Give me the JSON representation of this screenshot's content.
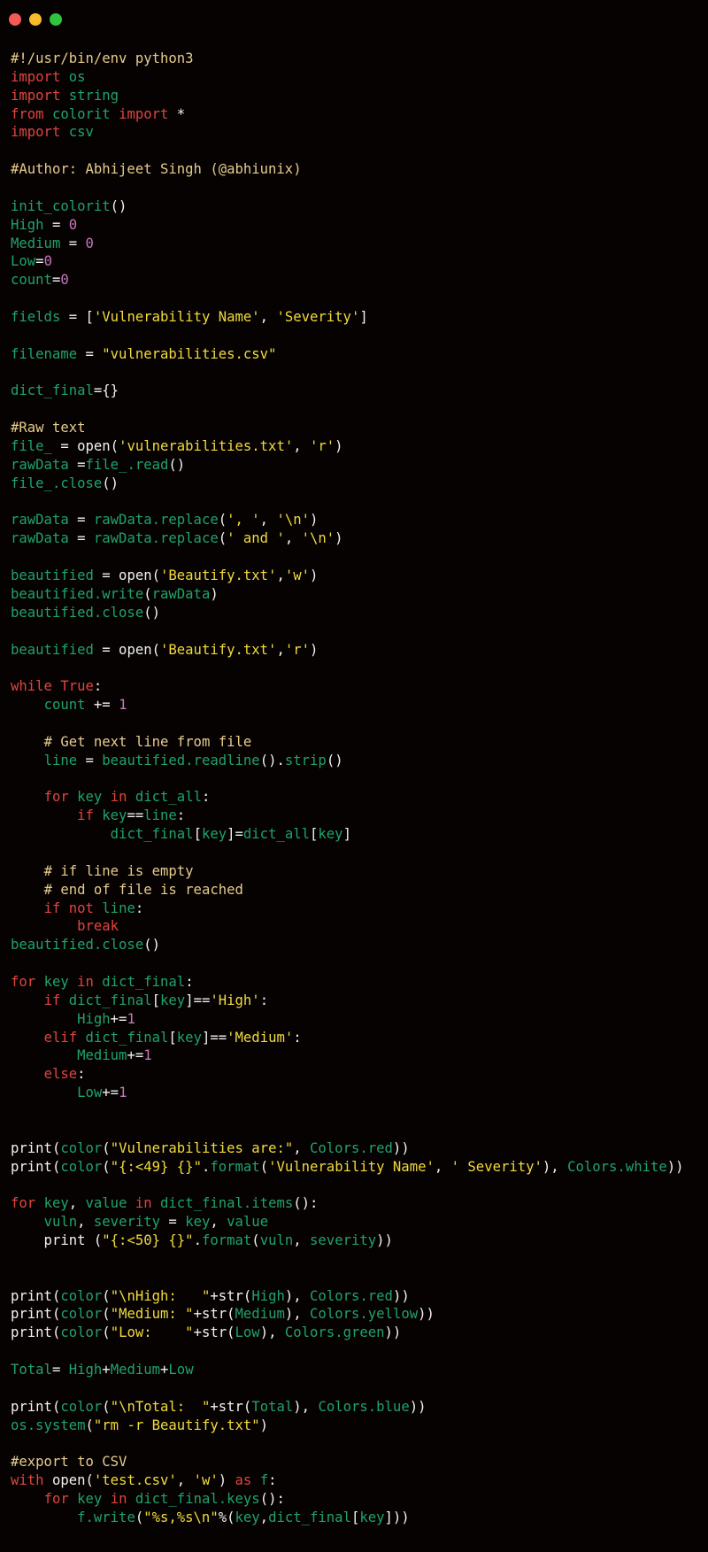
{
  "window": {
    "controls": [
      {
        "name": "close",
        "color": "#f25a57"
      },
      {
        "name": "minimize",
        "color": "#f6bb2e"
      },
      {
        "name": "maximize",
        "color": "#2fc43d"
      }
    ]
  },
  "theme": {
    "background": "#060202",
    "keyword": "#e0443e",
    "identifier": "#1fa36b",
    "string": "#f1db3c",
    "comment": "#e6cc8c",
    "number": "#c678b8",
    "plain": "#f2f2f2"
  },
  "code": {
    "language": "python",
    "lines": [
      [
        [
          "com",
          "#!/usr/bin/env python3"
        ]
      ],
      [
        [
          "kw",
          "import"
        ],
        [
          "op",
          " "
        ],
        [
          "id",
          "os"
        ]
      ],
      [
        [
          "kw",
          "import"
        ],
        [
          "op",
          " "
        ],
        [
          "id",
          "string"
        ]
      ],
      [
        [
          "kw",
          "from"
        ],
        [
          "op",
          " "
        ],
        [
          "id",
          "colorit"
        ],
        [
          "op",
          " "
        ],
        [
          "kw",
          "import"
        ],
        [
          "op",
          " *"
        ]
      ],
      [
        [
          "kw",
          "import"
        ],
        [
          "op",
          " "
        ],
        [
          "id",
          "csv"
        ]
      ],
      [],
      [
        [
          "com",
          "#Author: Abhijeet Singh (@abhiunix)"
        ]
      ],
      [],
      [
        [
          "id",
          "init_colorit"
        ],
        [
          "op",
          "()"
        ]
      ],
      [
        [
          "id",
          "High"
        ],
        [
          "op",
          " = "
        ],
        [
          "num",
          "0"
        ]
      ],
      [
        [
          "id",
          "Medium"
        ],
        [
          "op",
          " = "
        ],
        [
          "num",
          "0"
        ]
      ],
      [
        [
          "id",
          "Low"
        ],
        [
          "op",
          "="
        ],
        [
          "num",
          "0"
        ]
      ],
      [
        [
          "id",
          "count"
        ],
        [
          "op",
          "="
        ],
        [
          "num",
          "0"
        ]
      ],
      [],
      [
        [
          "id",
          "fields"
        ],
        [
          "op",
          " = ["
        ],
        [
          "str",
          "'Vulnerability Name'"
        ],
        [
          "op",
          ", "
        ],
        [
          "str",
          "'Severity'"
        ],
        [
          "op",
          "]"
        ]
      ],
      [],
      [
        [
          "id",
          "filename"
        ],
        [
          "op",
          " = "
        ],
        [
          "str",
          "\"vulnerabilities.csv\""
        ]
      ],
      [],
      [
        [
          "id",
          "dict_final"
        ],
        [
          "op",
          "={}"
        ]
      ],
      [],
      [
        [
          "com",
          "#Raw text"
        ]
      ],
      [
        [
          "id",
          "file_"
        ],
        [
          "op",
          " = open("
        ],
        [
          "str",
          "'vulnerabilities.txt'"
        ],
        [
          "op",
          ", "
        ],
        [
          "str",
          "'r'"
        ],
        [
          "op",
          ")"
        ]
      ],
      [
        [
          "id",
          "rawData"
        ],
        [
          "op",
          " ="
        ],
        [
          "id",
          "file_.read"
        ],
        [
          "op",
          "()"
        ]
      ],
      [
        [
          "id",
          "file_.close"
        ],
        [
          "op",
          "()"
        ]
      ],
      [],
      [
        [
          "id",
          "rawData"
        ],
        [
          "op",
          " = "
        ],
        [
          "id",
          "rawData.replace"
        ],
        [
          "op",
          "("
        ],
        [
          "str",
          "', '"
        ],
        [
          "op",
          ", "
        ],
        [
          "str",
          "'\\n'"
        ],
        [
          "op",
          ")"
        ]
      ],
      [
        [
          "id",
          "rawData"
        ],
        [
          "op",
          " = "
        ],
        [
          "id",
          "rawData.replace"
        ],
        [
          "op",
          "("
        ],
        [
          "str",
          "' and '"
        ],
        [
          "op",
          ", "
        ],
        [
          "str",
          "'\\n'"
        ],
        [
          "op",
          ")"
        ]
      ],
      [],
      [
        [
          "id",
          "beautified"
        ],
        [
          "op",
          " = open("
        ],
        [
          "str",
          "'Beautify.txt'"
        ],
        [
          "op",
          ","
        ],
        [
          "str",
          "'w'"
        ],
        [
          "op",
          ")"
        ]
      ],
      [
        [
          "id",
          "beautified.write"
        ],
        [
          "op",
          "("
        ],
        [
          "id",
          "rawData"
        ],
        [
          "op",
          ")"
        ]
      ],
      [
        [
          "id",
          "beautified.close"
        ],
        [
          "op",
          "()"
        ]
      ],
      [],
      [
        [
          "id",
          "beautified"
        ],
        [
          "op",
          " = open("
        ],
        [
          "str",
          "'Beautify.txt'"
        ],
        [
          "op",
          ","
        ],
        [
          "str",
          "'r'"
        ],
        [
          "op",
          ")"
        ]
      ],
      [],
      [
        [
          "kw",
          "while"
        ],
        [
          "op",
          " "
        ],
        [
          "kw",
          "True"
        ],
        [
          "op",
          ":"
        ]
      ],
      [
        [
          "op",
          "    "
        ],
        [
          "id",
          "count"
        ],
        [
          "op",
          " += "
        ],
        [
          "num",
          "1"
        ]
      ],
      [],
      [
        [
          "op",
          "    "
        ],
        [
          "com",
          "# Get next line from file"
        ]
      ],
      [
        [
          "op",
          "    "
        ],
        [
          "id",
          "line"
        ],
        [
          "op",
          " = "
        ],
        [
          "id",
          "beautified.readline"
        ],
        [
          "op",
          "()."
        ],
        [
          "id",
          "strip"
        ],
        [
          "op",
          "()"
        ]
      ],
      [],
      [
        [
          "op",
          "    "
        ],
        [
          "kw",
          "for"
        ],
        [
          "op",
          " "
        ],
        [
          "id",
          "key"
        ],
        [
          "op",
          " "
        ],
        [
          "kw",
          "in"
        ],
        [
          "op",
          " "
        ],
        [
          "id",
          "dict_all"
        ],
        [
          "op",
          ":"
        ]
      ],
      [
        [
          "op",
          "        "
        ],
        [
          "kw",
          "if"
        ],
        [
          "op",
          " "
        ],
        [
          "id",
          "key"
        ],
        [
          "op",
          "=="
        ],
        [
          "id",
          "line"
        ],
        [
          "op",
          ":"
        ]
      ],
      [
        [
          "op",
          "            "
        ],
        [
          "id",
          "dict_final"
        ],
        [
          "op",
          "["
        ],
        [
          "id",
          "key"
        ],
        [
          "op",
          "]="
        ],
        [
          "id",
          "dict_all"
        ],
        [
          "op",
          "["
        ],
        [
          "id",
          "key"
        ],
        [
          "op",
          "]"
        ]
      ],
      [],
      [
        [
          "op",
          "    "
        ],
        [
          "com",
          "# if line is empty"
        ]
      ],
      [
        [
          "op",
          "    "
        ],
        [
          "com",
          "# end of file is reached"
        ]
      ],
      [
        [
          "op",
          "    "
        ],
        [
          "kw",
          "if"
        ],
        [
          "op",
          " "
        ],
        [
          "kw",
          "not"
        ],
        [
          "op",
          " "
        ],
        [
          "id",
          "line"
        ],
        [
          "op",
          ":"
        ]
      ],
      [
        [
          "op",
          "        "
        ],
        [
          "kw",
          "break"
        ]
      ],
      [
        [
          "id",
          "beautified.close"
        ],
        [
          "op",
          "()"
        ]
      ],
      [],
      [
        [
          "kw",
          "for"
        ],
        [
          "op",
          " "
        ],
        [
          "id",
          "key"
        ],
        [
          "op",
          " "
        ],
        [
          "kw",
          "in"
        ],
        [
          "op",
          " "
        ],
        [
          "id",
          "dict_final"
        ],
        [
          "op",
          ":"
        ]
      ],
      [
        [
          "op",
          "    "
        ],
        [
          "kw",
          "if"
        ],
        [
          "op",
          " "
        ],
        [
          "id",
          "dict_final"
        ],
        [
          "op",
          "["
        ],
        [
          "id",
          "key"
        ],
        [
          "op",
          "]=="
        ],
        [
          "str",
          "'High'"
        ],
        [
          "op",
          ":"
        ]
      ],
      [
        [
          "op",
          "        "
        ],
        [
          "id",
          "High"
        ],
        [
          "op",
          "+="
        ],
        [
          "num",
          "1"
        ]
      ],
      [
        [
          "op",
          "    "
        ],
        [
          "kw",
          "elif"
        ],
        [
          "op",
          " "
        ],
        [
          "id",
          "dict_final"
        ],
        [
          "op",
          "["
        ],
        [
          "id",
          "key"
        ],
        [
          "op",
          "]=="
        ],
        [
          "str",
          "'Medium'"
        ],
        [
          "op",
          ":"
        ]
      ],
      [
        [
          "op",
          "        "
        ],
        [
          "id",
          "Medium"
        ],
        [
          "op",
          "+="
        ],
        [
          "num",
          "1"
        ]
      ],
      [
        [
          "op",
          "    "
        ],
        [
          "kw",
          "else"
        ],
        [
          "op",
          ":"
        ]
      ],
      [
        [
          "op",
          "        "
        ],
        [
          "id",
          "Low"
        ],
        [
          "op",
          "+="
        ],
        [
          "num",
          "1"
        ]
      ],
      [],
      [],
      [
        [
          "op",
          "print("
        ],
        [
          "id",
          "color"
        ],
        [
          "op",
          "("
        ],
        [
          "str",
          "\"Vulnerabilities are:\""
        ],
        [
          "op",
          ", "
        ],
        [
          "id",
          "Colors.red"
        ],
        [
          "op",
          "))"
        ]
      ],
      [
        [
          "op",
          "print("
        ],
        [
          "id",
          "color"
        ],
        [
          "op",
          "("
        ],
        [
          "str",
          "\"{:<49} {}\""
        ],
        [
          "op",
          "."
        ],
        [
          "id",
          "format"
        ],
        [
          "op",
          "("
        ],
        [
          "str",
          "'Vulnerability Name'"
        ],
        [
          "op",
          ", "
        ],
        [
          "str",
          "' Severity'"
        ],
        [
          "op",
          "), "
        ],
        [
          "id",
          "Colors.white"
        ],
        [
          "op",
          "))"
        ]
      ],
      [],
      [
        [
          "kw",
          "for"
        ],
        [
          "op",
          " "
        ],
        [
          "id",
          "key"
        ],
        [
          "op",
          ", "
        ],
        [
          "id",
          "value"
        ],
        [
          "op",
          " "
        ],
        [
          "kw",
          "in"
        ],
        [
          "op",
          " "
        ],
        [
          "id",
          "dict_final.items"
        ],
        [
          "op",
          "():"
        ]
      ],
      [
        [
          "op",
          "    "
        ],
        [
          "id",
          "vuln"
        ],
        [
          "op",
          ", "
        ],
        [
          "id",
          "severity"
        ],
        [
          "op",
          " = "
        ],
        [
          "id",
          "key"
        ],
        [
          "op",
          ", "
        ],
        [
          "id",
          "value"
        ]
      ],
      [
        [
          "op",
          "    print ("
        ],
        [
          "str",
          "\"{:<50} {}\""
        ],
        [
          "op",
          "."
        ],
        [
          "id",
          "format"
        ],
        [
          "op",
          "("
        ],
        [
          "id",
          "vuln"
        ],
        [
          "op",
          ", "
        ],
        [
          "id",
          "severity"
        ],
        [
          "op",
          "))"
        ]
      ],
      [],
      [],
      [
        [
          "op",
          "print("
        ],
        [
          "id",
          "color"
        ],
        [
          "op",
          "("
        ],
        [
          "str",
          "\"\\nHigh:   \""
        ],
        [
          "op",
          "+str("
        ],
        [
          "id",
          "High"
        ],
        [
          "op",
          "), "
        ],
        [
          "id",
          "Colors.red"
        ],
        [
          "op",
          "))"
        ]
      ],
      [
        [
          "op",
          "print("
        ],
        [
          "id",
          "color"
        ],
        [
          "op",
          "("
        ],
        [
          "str",
          "\"Medium: \""
        ],
        [
          "op",
          "+str("
        ],
        [
          "id",
          "Medium"
        ],
        [
          "op",
          "), "
        ],
        [
          "id",
          "Colors.yellow"
        ],
        [
          "op",
          "))"
        ]
      ],
      [
        [
          "op",
          "print("
        ],
        [
          "id",
          "color"
        ],
        [
          "op",
          "("
        ],
        [
          "str",
          "\"Low:    \""
        ],
        [
          "op",
          "+str("
        ],
        [
          "id",
          "Low"
        ],
        [
          "op",
          "), "
        ],
        [
          "id",
          "Colors.green"
        ],
        [
          "op",
          "))"
        ]
      ],
      [],
      [
        [
          "id",
          "Total"
        ],
        [
          "op",
          "= "
        ],
        [
          "id",
          "High"
        ],
        [
          "op",
          "+"
        ],
        [
          "id",
          "Medium"
        ],
        [
          "op",
          "+"
        ],
        [
          "id",
          "Low"
        ]
      ],
      [],
      [
        [
          "op",
          "print("
        ],
        [
          "id",
          "color"
        ],
        [
          "op",
          "("
        ],
        [
          "str",
          "\"\\nTotal:  \""
        ],
        [
          "op",
          "+str("
        ],
        [
          "id",
          "Total"
        ],
        [
          "op",
          "), "
        ],
        [
          "id",
          "Colors.blue"
        ],
        [
          "op",
          "))"
        ]
      ],
      [
        [
          "id",
          "os.system"
        ],
        [
          "op",
          "("
        ],
        [
          "str",
          "\"rm -r Beautify.txt\""
        ],
        [
          "op",
          ")"
        ]
      ],
      [],
      [
        [
          "com",
          "#export to CSV"
        ]
      ],
      [
        [
          "kw",
          "with"
        ],
        [
          "op",
          " open("
        ],
        [
          "str",
          "'test.csv'"
        ],
        [
          "op",
          ", "
        ],
        [
          "str",
          "'w'"
        ],
        [
          "op",
          ") "
        ],
        [
          "kw",
          "as"
        ],
        [
          "op",
          " "
        ],
        [
          "id",
          "f"
        ],
        [
          "op",
          ":"
        ]
      ],
      [
        [
          "op",
          "    "
        ],
        [
          "kw",
          "for"
        ],
        [
          "op",
          " "
        ],
        [
          "id",
          "key"
        ],
        [
          "op",
          " "
        ],
        [
          "kw",
          "in"
        ],
        [
          "op",
          " "
        ],
        [
          "id",
          "dict_final.keys"
        ],
        [
          "op",
          "():"
        ]
      ],
      [
        [
          "op",
          "        "
        ],
        [
          "id",
          "f.write"
        ],
        [
          "op",
          "("
        ],
        [
          "str",
          "\"%s,%s\\n\""
        ],
        [
          "op",
          "%("
        ],
        [
          "id",
          "key"
        ],
        [
          "op",
          ","
        ],
        [
          "id",
          "dict_final"
        ],
        [
          "op",
          "["
        ],
        [
          "id",
          "key"
        ],
        [
          "op",
          "]))"
        ]
      ]
    ]
  }
}
